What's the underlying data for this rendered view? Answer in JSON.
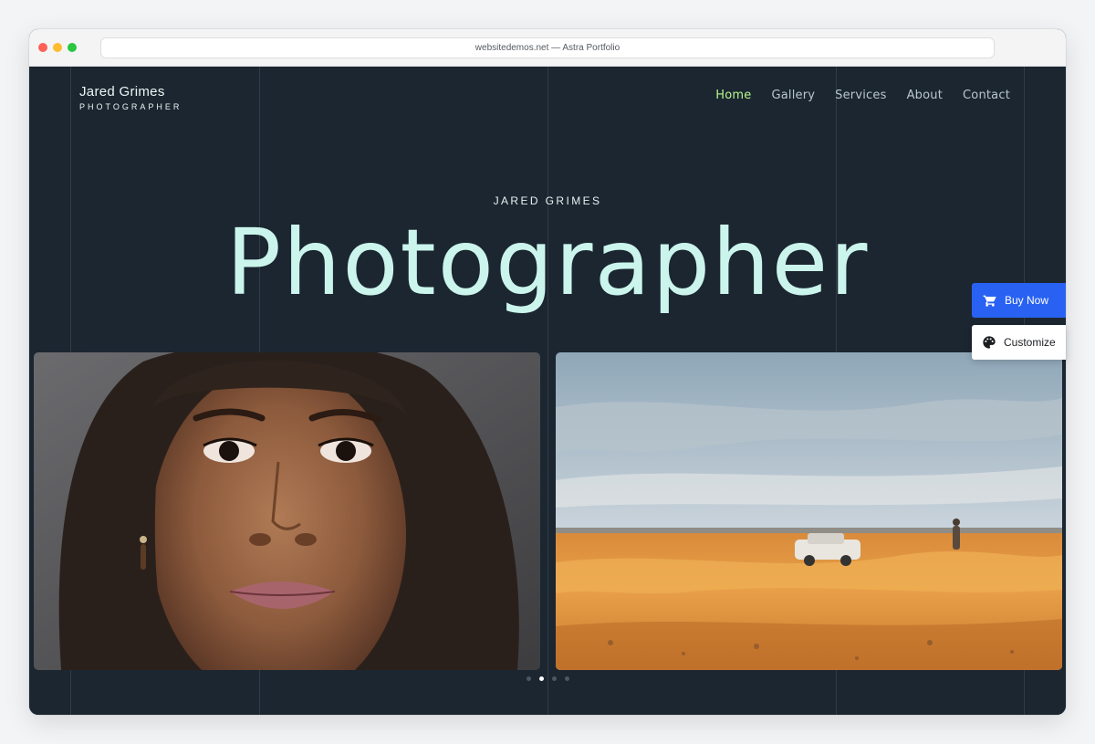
{
  "browser": {
    "url": "websitedemos.net — Astra Portfolio"
  },
  "brand": {
    "name": "Jared Grimes",
    "tagline": "PHOTOGRAPHER"
  },
  "nav": {
    "items": [
      {
        "label": "Home",
        "active": true
      },
      {
        "label": "Gallery",
        "active": false
      },
      {
        "label": "Services",
        "active": false
      },
      {
        "label": "About",
        "active": false
      },
      {
        "label": "Contact",
        "active": false
      }
    ]
  },
  "hero": {
    "kicker": "JARED GRIMES",
    "title": "Photographer"
  },
  "gallery": {
    "images": [
      "portrait-photo",
      "desert-landscape-photo"
    ],
    "slider_dots": 4,
    "active_dot": 1
  },
  "floating": {
    "buy_now": "Buy Now",
    "customize": "Customize"
  },
  "colors": {
    "background": "#1b2631",
    "accent_nav": "#b8f58d",
    "hero_title": "#cbf5ec",
    "buy_button": "#2962f2"
  }
}
